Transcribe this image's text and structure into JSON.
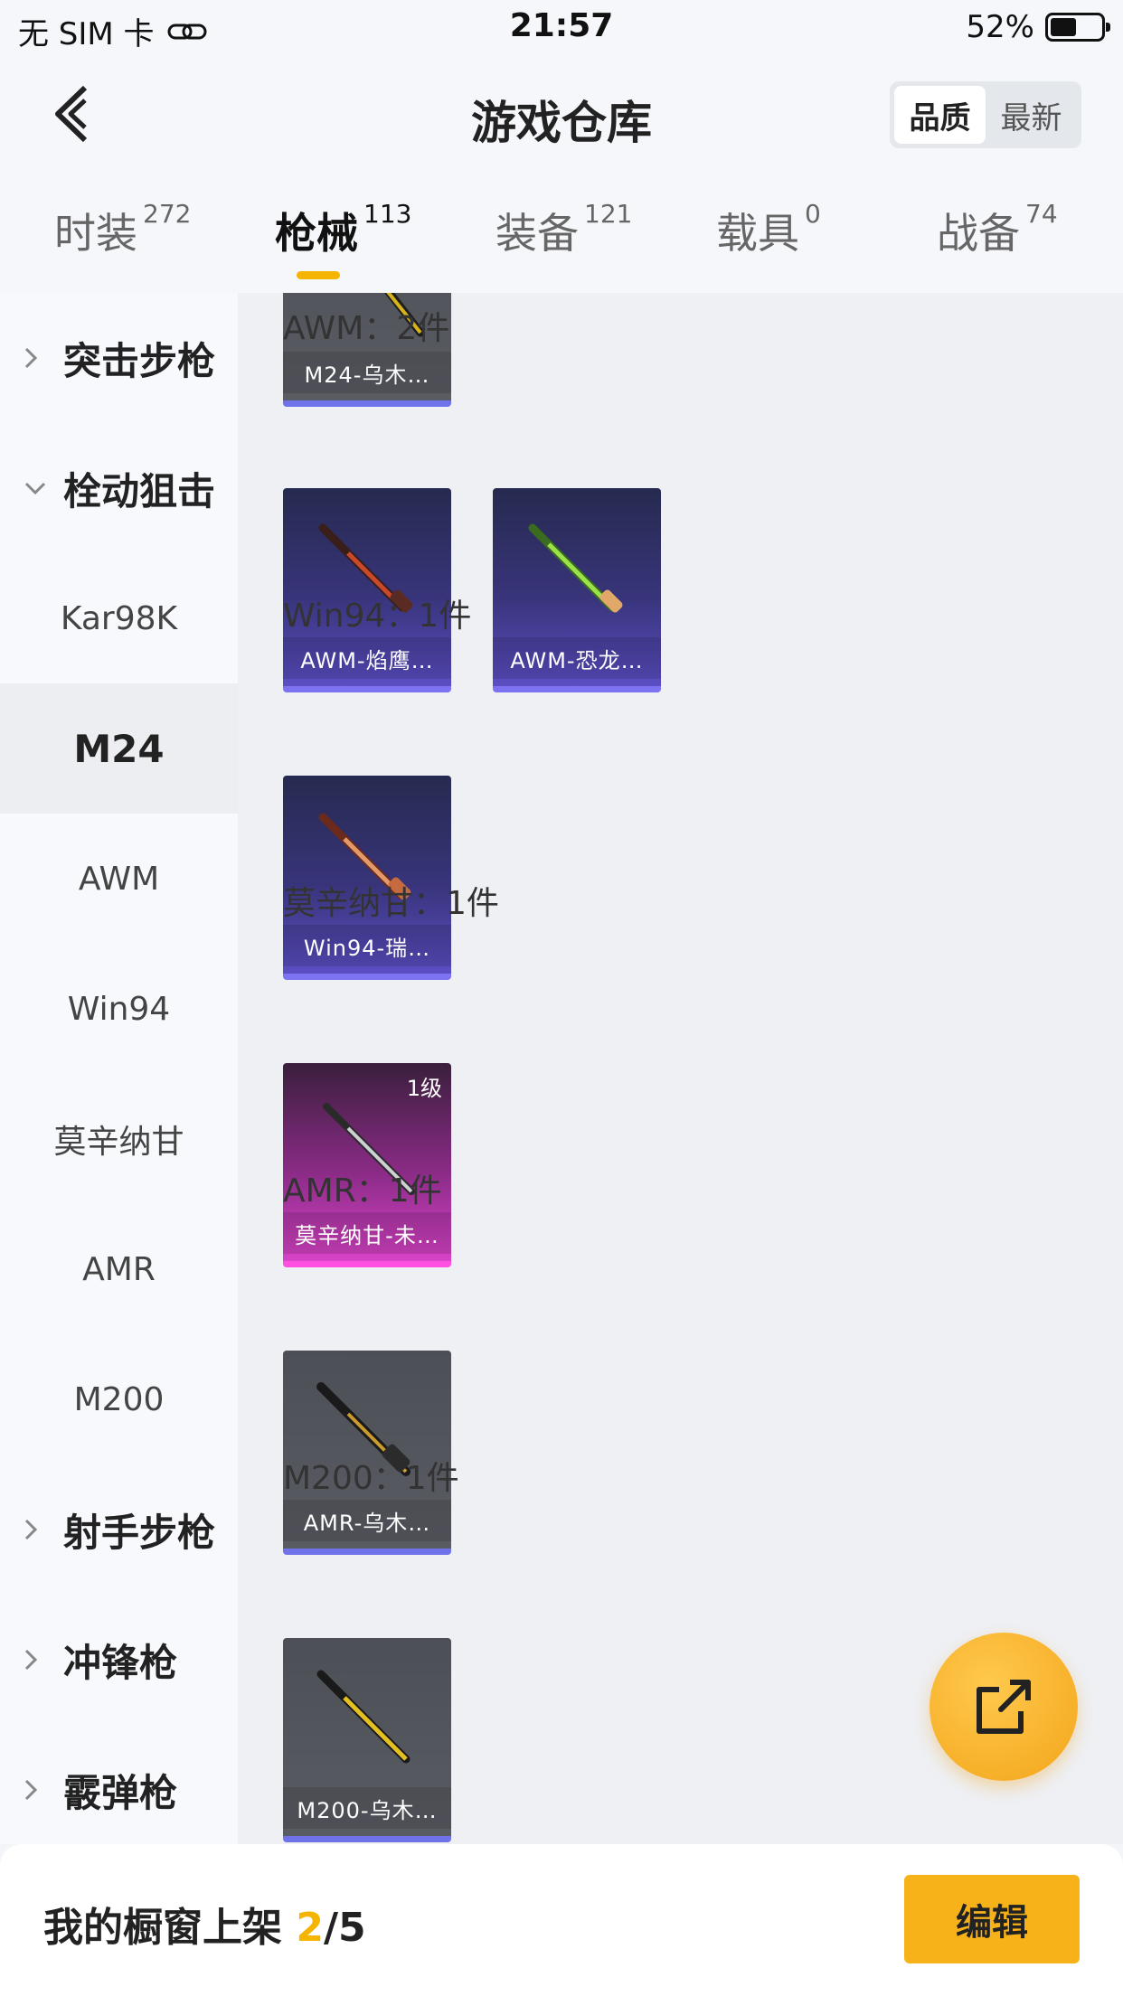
{
  "status_bar": {
    "carrier": "无 SIM 卡",
    "time": "21:57",
    "battery": "52%",
    "battery_level": 0.52
  },
  "nav": {
    "title": "游戏仓库",
    "sort_options": [
      "品质",
      "最新"
    ],
    "active_sort": "品质"
  },
  "tabs": [
    {
      "label": "时装",
      "count": "272"
    },
    {
      "label": "枪械",
      "count": "113"
    },
    {
      "label": "装备",
      "count": "121"
    },
    {
      "label": "载具",
      "count": "0"
    },
    {
      "label": "战备",
      "count": "74"
    }
  ],
  "active_tab": "枪械",
  "sidebar": {
    "groups": [
      {
        "label": "突击步枪"
      },
      {
        "label": "栓动狙击"
      },
      {
        "label": "射手步枪"
      },
      {
        "label": "冲锋枪"
      },
      {
        "label": "霰弹枪"
      }
    ],
    "subitems": [
      "Kar98K",
      "M24",
      "AWM",
      "Win94",
      "莫辛纳甘",
      "AMR",
      "M200"
    ],
    "active_subitem": "M24"
  },
  "content": {
    "sections": [
      {
        "title": "AWM：2件"
      },
      {
        "title": "Win94：1件"
      },
      {
        "title": "莫辛纳甘：1件"
      },
      {
        "title": "AMR：1件"
      },
      {
        "title": "M200：1件"
      }
    ],
    "cards": [
      {
        "label": "M24-乌木…",
        "rarity": "gray"
      },
      {
        "label": "AWM-焰鹰…",
        "rarity": "purple"
      },
      {
        "label": "AWM-恐龙…",
        "rarity": "purple"
      },
      {
        "label": "Win94-瑞…",
        "rarity": "purple"
      },
      {
        "label": "莫辛纳甘-未…",
        "rarity": "pink",
        "level": "1级"
      },
      {
        "label": "AMR-乌木…",
        "rarity": "gray"
      },
      {
        "label": "M200-乌木…",
        "rarity": "gray"
      }
    ]
  },
  "bottom": {
    "showcase_label": "我的橱窗上架",
    "showcase_count": "2",
    "showcase_total": "/5",
    "edit_label": "编辑"
  },
  "colors": {
    "accent": "#f5b400",
    "rarity_gray_bar": "#6f72e9",
    "rarity_purple_bar": "#7d73f2",
    "rarity_pink_bar": "#ff4fe0"
  }
}
